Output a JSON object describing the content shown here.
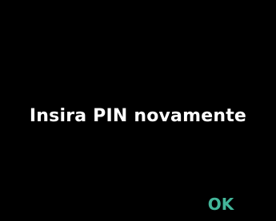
{
  "screen": {
    "prompt": "Insira PIN novamente",
    "ok_label": "OK"
  },
  "colors": {
    "background": "#000000",
    "text": "#ffffff",
    "accent": "#43b69a"
  }
}
